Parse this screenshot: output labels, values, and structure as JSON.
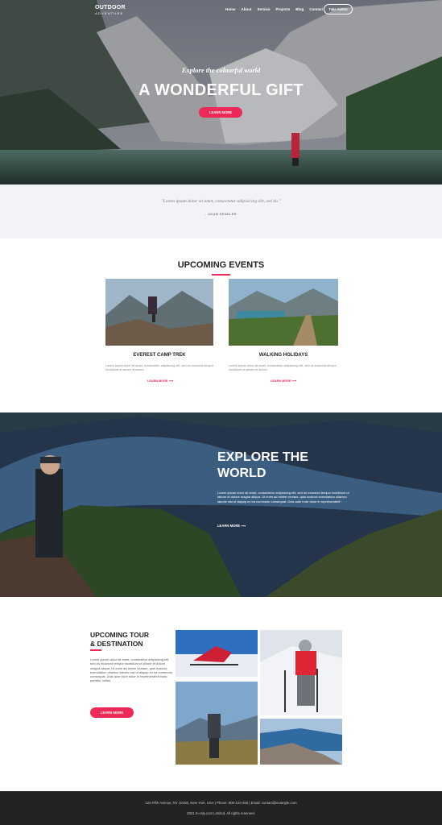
{
  "nav": {
    "logo_line1": "OUTDOOR",
    "logo_line2": "ADVENTURE",
    "menu": [
      "Home",
      "About",
      "Service",
      "Projects",
      "Blog",
      "Contact"
    ],
    "cta": "Take Action"
  },
  "hero": {
    "subtitle": "Explore the colourful world",
    "title": "A WONDERFUL GIFT",
    "button": "LEARN MORE"
  },
  "quote": {
    "text": "\"Lorem ipsum dolor sit amet, consectetur adipisicing elit, sed do.\"",
    "author": "- ADAM SENDLER"
  },
  "events": {
    "title": "UPCOMING EVENTS",
    "cards": [
      {
        "title": "EVEREST CAMP TREK",
        "text": "Lorem ipsum dolor sit amet, consectetur adipisicing elit, sed do eiusmod tempor incididunt ut labore et dolore.",
        "link": "LEARN MORE ⟶"
      },
      {
        "title": "WALKING HOLIDAYS",
        "text": "Lorem ipsum dolor sit amet, consectetur adipisicing elit, sed do eiusmod tempor incididunt ut labore et dolore.",
        "link": "LEARN MORE ⟶"
      }
    ]
  },
  "explore": {
    "title_line1": "EXPLORE THE",
    "title_line2": "WORLD",
    "text": "Lorem ipsum dolor sit amet, consectetur adipisicing elit, sed do eiusmod tempor incididunt ut labore et dolore magna aliqua. Ut enim ad minim veniam, quis nostrud exercitation ullamco laboris nisi ut aliquip ex ea commodo consequat. Duis aute irure dolor in reprehenderit .",
    "link": "LEARN MORE ⟶"
  },
  "tour": {
    "title_line1": "UPCOMING TOUR",
    "title_line2": "& DESTINATION",
    "text": "Lorem ipsum dolor sit amet, consectetur adipisicing elit, sed do eiusmod tempor incididunt ut labore et dolore magna aliqua. Ut enim ad minim veniam, quis nostrud exercitation ullamco laboris nisi ut aliquip ex ea commodo consequat. Duis aute irure dolor in reprehenderit nulla pariatur nullus.",
    "button": "LEARN MORE"
  },
  "footer": {
    "address": "123 Fifth Avenue, NY 10160, New York, USA | Phone: 800-123-456 | Email: contact@example.com",
    "copyright": "2021 E-only.com Limited. All rights reserved."
  },
  "colors": {
    "accent": "#ec2957",
    "footer_bg": "#232323",
    "quote_bg": "#f2f3f7"
  }
}
